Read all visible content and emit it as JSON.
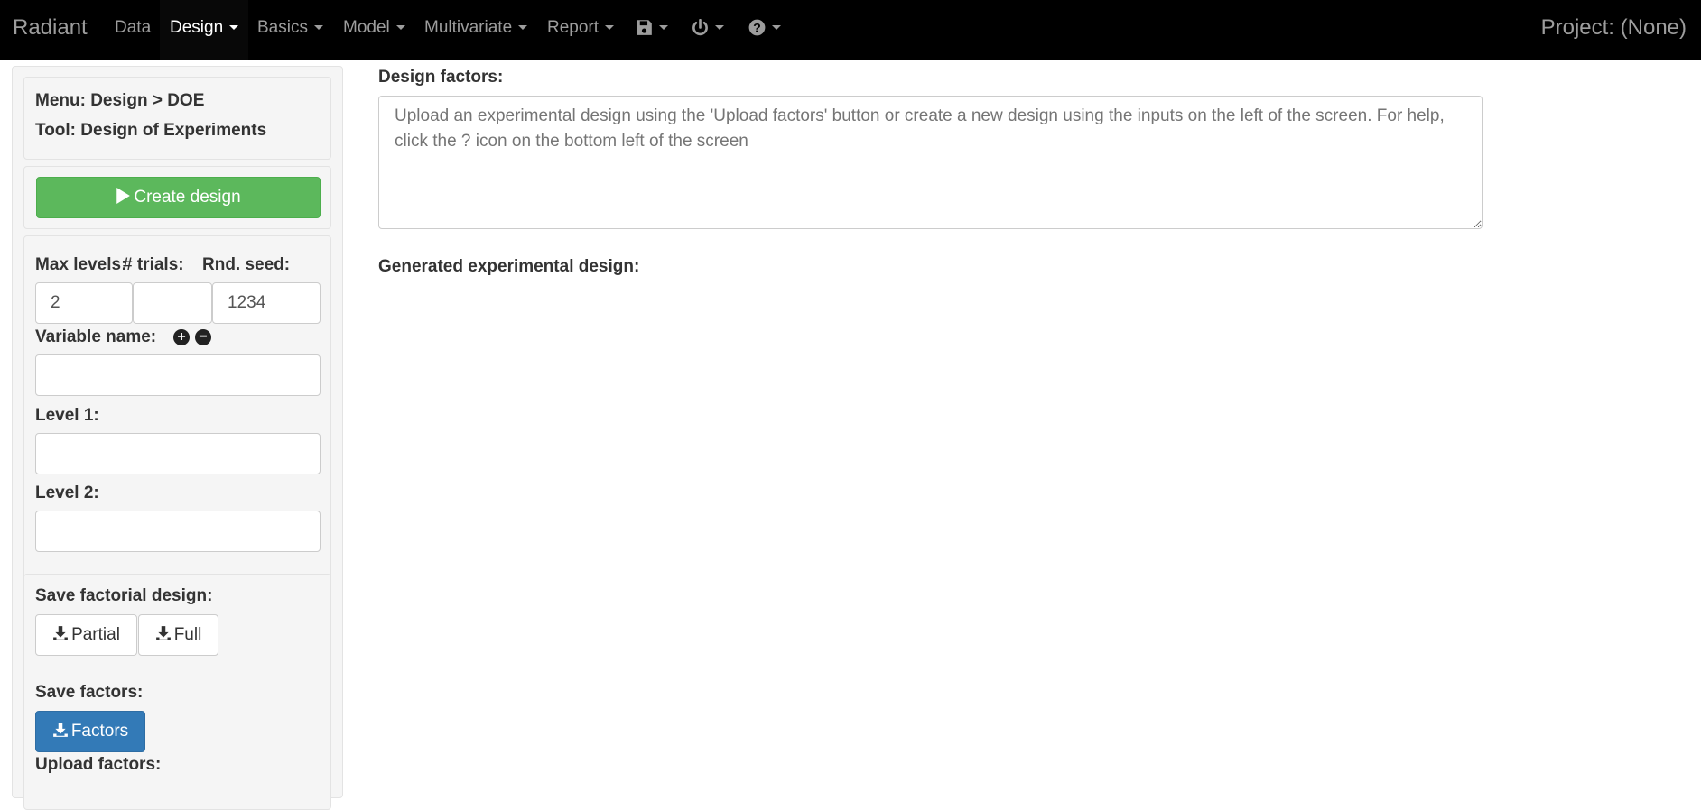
{
  "navbar": {
    "brand": "Radiant",
    "items": [
      {
        "label": "Data"
      },
      {
        "label": "Design"
      },
      {
        "label": "Basics"
      },
      {
        "label": "Model"
      },
      {
        "label": "Multivariate"
      },
      {
        "label": "Report"
      }
    ],
    "icons": [
      "save-icon",
      "power-icon",
      "help-icon"
    ],
    "project": "Project: (None)"
  },
  "sidebar": {
    "menu_path": "Menu: Design > DOE",
    "tool": "Tool: Design of Experiments",
    "create_button": "Create design",
    "max_levels_label": "Max levels:",
    "trials_label": "# trials:",
    "seed_label": "Rnd. seed:",
    "max_levels_value": "2",
    "trials_value": "",
    "seed_value": "1234",
    "variable_name_label": "Variable name:",
    "level1_label": "Level 1:",
    "level2_label": "Level 2:",
    "save_factorial_label": "Save factorial design:",
    "partial_button": "Partial",
    "full_button": "Full",
    "save_factors_label": "Save factors:",
    "factors_button": "Factors",
    "upload_factors_label": "Upload factors:"
  },
  "main": {
    "design_factors_label": "Design factors:",
    "design_factors_placeholder": "Upload an experimental design using the 'Upload factors' button or create a new design using the inputs on the left of the screen. For help, click the ? icon on the bottom left of the screen",
    "generated_label": "Generated experimental design:"
  },
  "colors": {
    "navbar_bg": "#000000",
    "create_button": "#5cb85c",
    "factors_button": "#337ab7"
  }
}
